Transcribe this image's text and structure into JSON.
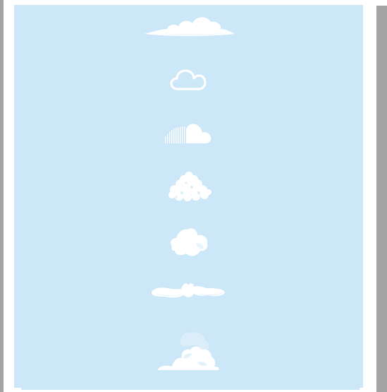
{
  "colors": {
    "background_sheet": "#cce7f8",
    "frame": "#a3a3a3",
    "cloud_fill": "#ffffff",
    "cloud_shade": "#e2f2fc"
  },
  "icons": [
    "stratus-cloud-icon",
    "outline-cloud-icon",
    "soundcloud-style-cloud-icon",
    "fluffy-cumulus-cloud-icon",
    "puffy-cloud-icon",
    "wispy-elongated-cloud-icon",
    "tall-cumulonimbus-cloud-icon"
  ]
}
